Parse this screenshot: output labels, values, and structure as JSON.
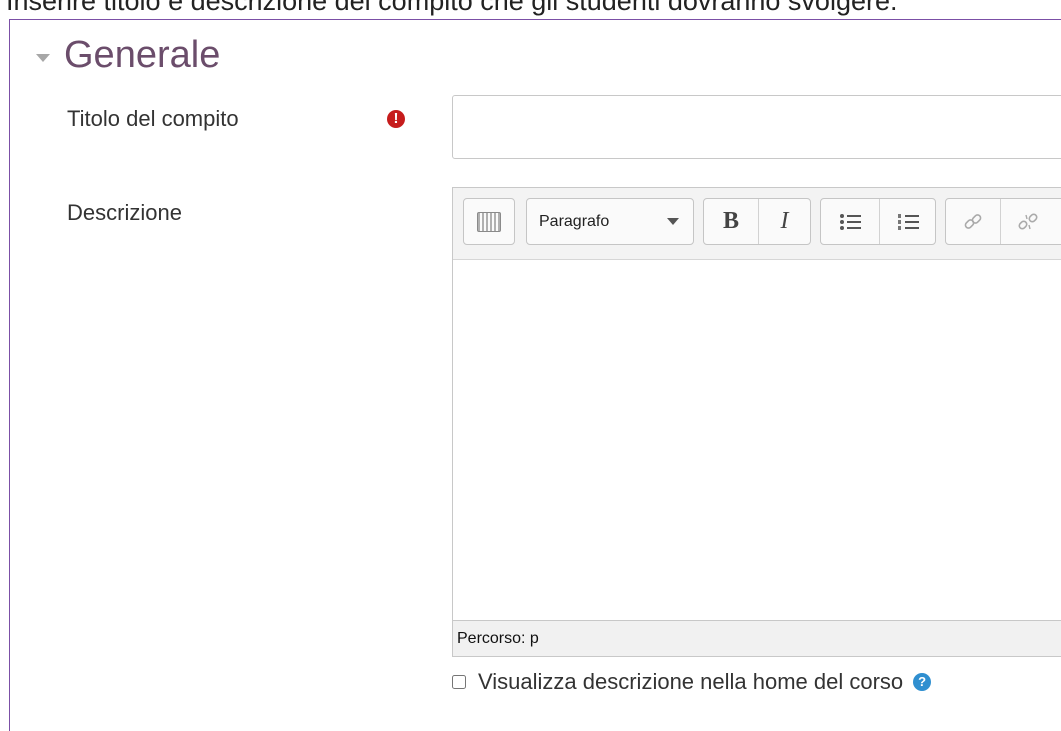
{
  "caption": "Inserire titolo e descrizione del compito che gli studenti dovranno svolgere.",
  "section": {
    "title": "Generale"
  },
  "fields": {
    "title_label": "Titolo del compito",
    "title_value": "",
    "required_icon_glyph": "!",
    "description_label": "Descrizione"
  },
  "editor": {
    "paragraph_format": "Paragrafo",
    "bold_glyph": "B",
    "italic_glyph": "I",
    "path_text": "Percorso: p"
  },
  "options": {
    "show_description_label": "Visualizza descrizione nella home del corso",
    "show_description_checked": false,
    "help_glyph": "?"
  },
  "colors": {
    "section_title": "#6b4d6b",
    "required": "#c61c1c",
    "help": "#2f8fd0",
    "frame": "#7b4fa6"
  }
}
